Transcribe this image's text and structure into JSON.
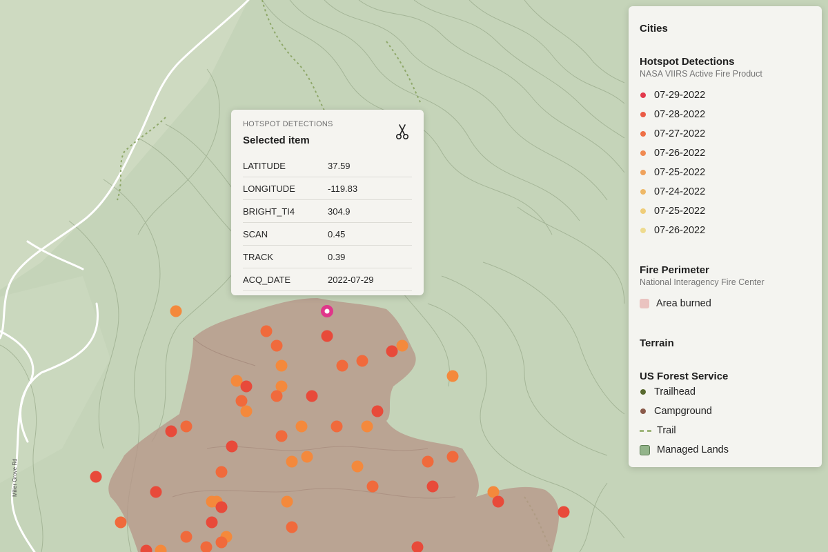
{
  "popup": {
    "kicker": "HOTSPOT DETECTIONS",
    "title": "Selected item",
    "icon": "scissors-icon",
    "rows": [
      {
        "key": "LATITUDE",
        "value": "37.59"
      },
      {
        "key": "LONGITUDE",
        "value": "-119.83"
      },
      {
        "key": "BRIGHT_TI4",
        "value": "304.9"
      },
      {
        "key": "SCAN",
        "value": "0.45"
      },
      {
        "key": "TRACK",
        "value": "0.39"
      },
      {
        "key": "ACQ_DATE",
        "value": "2022-07-29"
      }
    ]
  },
  "legend": {
    "cities": "Cities",
    "hotspots": {
      "title": "Hotspot Detections",
      "source": "NASA VIIRS Active Fire Product",
      "items": [
        {
          "label": "07-29-2022",
          "color": "#e23a4c"
        },
        {
          "label": "07-28-2022",
          "color": "#ea5a45"
        },
        {
          "label": "07-27-2022",
          "color": "#ee7046"
        },
        {
          "label": "07-26-2022",
          "color": "#f08a52"
        },
        {
          "label": "07-25-2022",
          "color": "#efa25c"
        },
        {
          "label": "07-24-2022",
          "color": "#eeb867"
        },
        {
          "label": "07-25-2022",
          "color": "#efcd79"
        },
        {
          "label": "07-26-2022",
          "color": "#eedb8f"
        }
      ]
    },
    "fire": {
      "title": "Fire Perimeter",
      "source": "National Interagency Fire Center",
      "area_label": "Area burned",
      "area_color": "#eac3c0"
    },
    "terrain": "Terrain",
    "usfs": {
      "title": "US Forest Service",
      "trailhead": "Trailhead",
      "trailhead_color": "#58692f",
      "campground": "Campground",
      "campground_color": "#8a5a4a",
      "trail": "Trail",
      "managed": "Managed Lands",
      "managed_color": "#93b48a"
    }
  },
  "map": {
    "road_label": "Miller Grove Rd",
    "hotspot_colors": [
      "#e84a3a",
      "#f06a3c",
      "#f4893c"
    ],
    "selected_color": "#e0368a"
  }
}
